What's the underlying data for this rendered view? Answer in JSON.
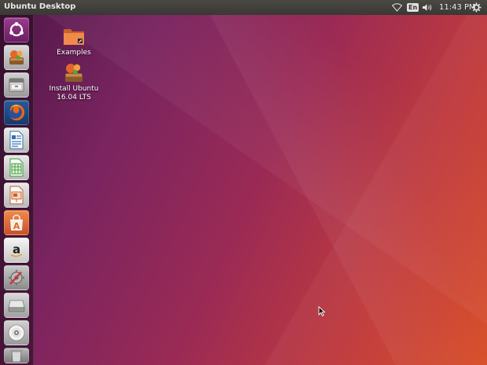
{
  "panel": {
    "title": "Ubuntu Desktop",
    "keyboard_layout": "En",
    "clock": "11:43 PM",
    "indicators": [
      "wifi-icon",
      "keyboard-layout",
      "sound-icon",
      "clock",
      "gear-icon"
    ]
  },
  "launcher": {
    "items": [
      {
        "name": "ubuntu-dash",
        "icon": "ubuntu-logo-icon",
        "color": "#7a2a70"
      },
      {
        "name": "install-ubuntu",
        "icon": "ubuntu-installer-icon",
        "color": "#c07a3a"
      },
      {
        "name": "files",
        "icon": "file-cabinet-icon",
        "color": "#8c8c8c"
      },
      {
        "name": "firefox",
        "icon": "firefox-icon",
        "color": "#e0661c"
      },
      {
        "name": "libreoffice-writer",
        "icon": "writer-icon",
        "color": "#2f6fb5"
      },
      {
        "name": "libreoffice-calc",
        "icon": "calc-icon",
        "color": "#3a9a3a"
      },
      {
        "name": "libreoffice-impress",
        "icon": "impress-icon",
        "color": "#c9602a"
      },
      {
        "name": "ubuntu-software",
        "icon": "software-center-icon",
        "color": "#e0662a"
      },
      {
        "name": "amazon",
        "icon": "amazon-icon",
        "color": "#dcdcdc"
      },
      {
        "name": "system-settings",
        "icon": "settings-tools-icon",
        "color": "#b53a3a"
      },
      {
        "name": "drive",
        "icon": "drive-icon",
        "color": "#9a9a9a"
      },
      {
        "name": "optical-disc",
        "icon": "cd-icon",
        "color": "#a8a8a8"
      },
      {
        "name": "trash",
        "icon": "trash-icon",
        "color": "#8a8a8a"
      }
    ]
  },
  "desktop": {
    "icons": [
      {
        "label": "Examples",
        "icon": "folder-icon"
      },
      {
        "label_line1": "Install Ubuntu",
        "label_line2": "16.04 LTS",
        "icon": "ubuntu-installer-icon"
      }
    ]
  },
  "colors": {
    "panel_bg": "#3c3b37",
    "launcher_bg": "#2a0c20",
    "accent": "#dd4814"
  }
}
